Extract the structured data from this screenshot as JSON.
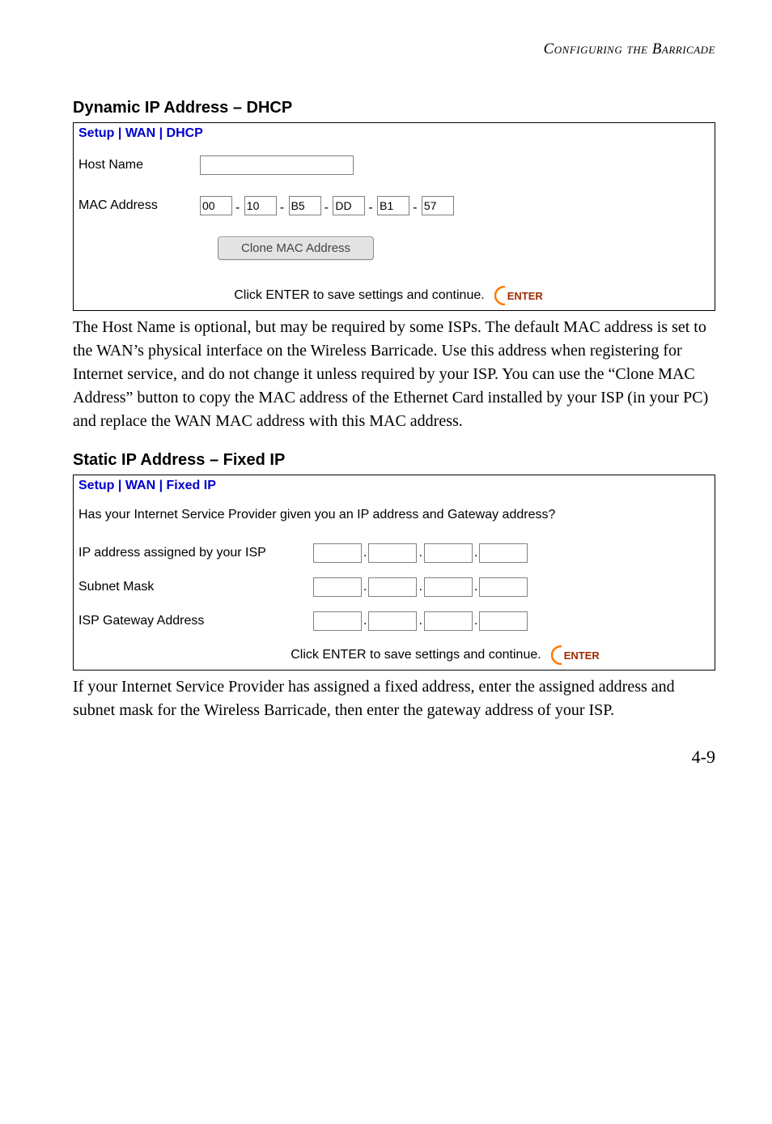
{
  "header": {
    "running": "Configuring the Barricade"
  },
  "dhcp": {
    "heading": "Dynamic IP Address – DHCP",
    "breadcrumb": "Setup | WAN | DHCP",
    "host_label": "Host Name",
    "host_value": "",
    "mac_label": "MAC Address",
    "mac": [
      "00",
      "10",
      "B5",
      "DD",
      "B1",
      "57"
    ],
    "sep": "-",
    "clone_btn": "Clone MAC Address",
    "save_text": "Click ENTER to save settings and continue.",
    "enter_text": "ENTER"
  },
  "body1": "The Host Name is optional, but may be required by some ISPs. The default MAC address is set to the WAN’s physical interface on the Wireless Barricade. Use this address when registering for Internet service, and do not change it unless required by your ISP. You can use the “Clone MAC Address” button to copy the MAC address of the Ethernet Card installed by your ISP (in your PC) and replace the WAN MAC address with this MAC address.",
  "fixed": {
    "heading": "Static IP Address – Fixed IP",
    "breadcrumb": "Setup | WAN | Fixed IP",
    "question": "Has your Internet Service Provider given you an IP address and Gateway address?",
    "ip_label": "IP address assigned by your ISP",
    "mask_label": "Subnet Mask",
    "gw_label": "ISP Gateway Address",
    "save_text": "Click ENTER to save settings and continue.",
    "enter_text": "ENTER",
    "dot": "."
  },
  "body2": "If your Internet Service Provider has assigned a fixed address, enter the assigned address and subnet mask for the Wireless Barricade, then enter the gateway address of your ISP.",
  "page_num": "4-9",
  "colors": {
    "accent": "#ff7a00",
    "enter_dark": "#a12b00"
  }
}
